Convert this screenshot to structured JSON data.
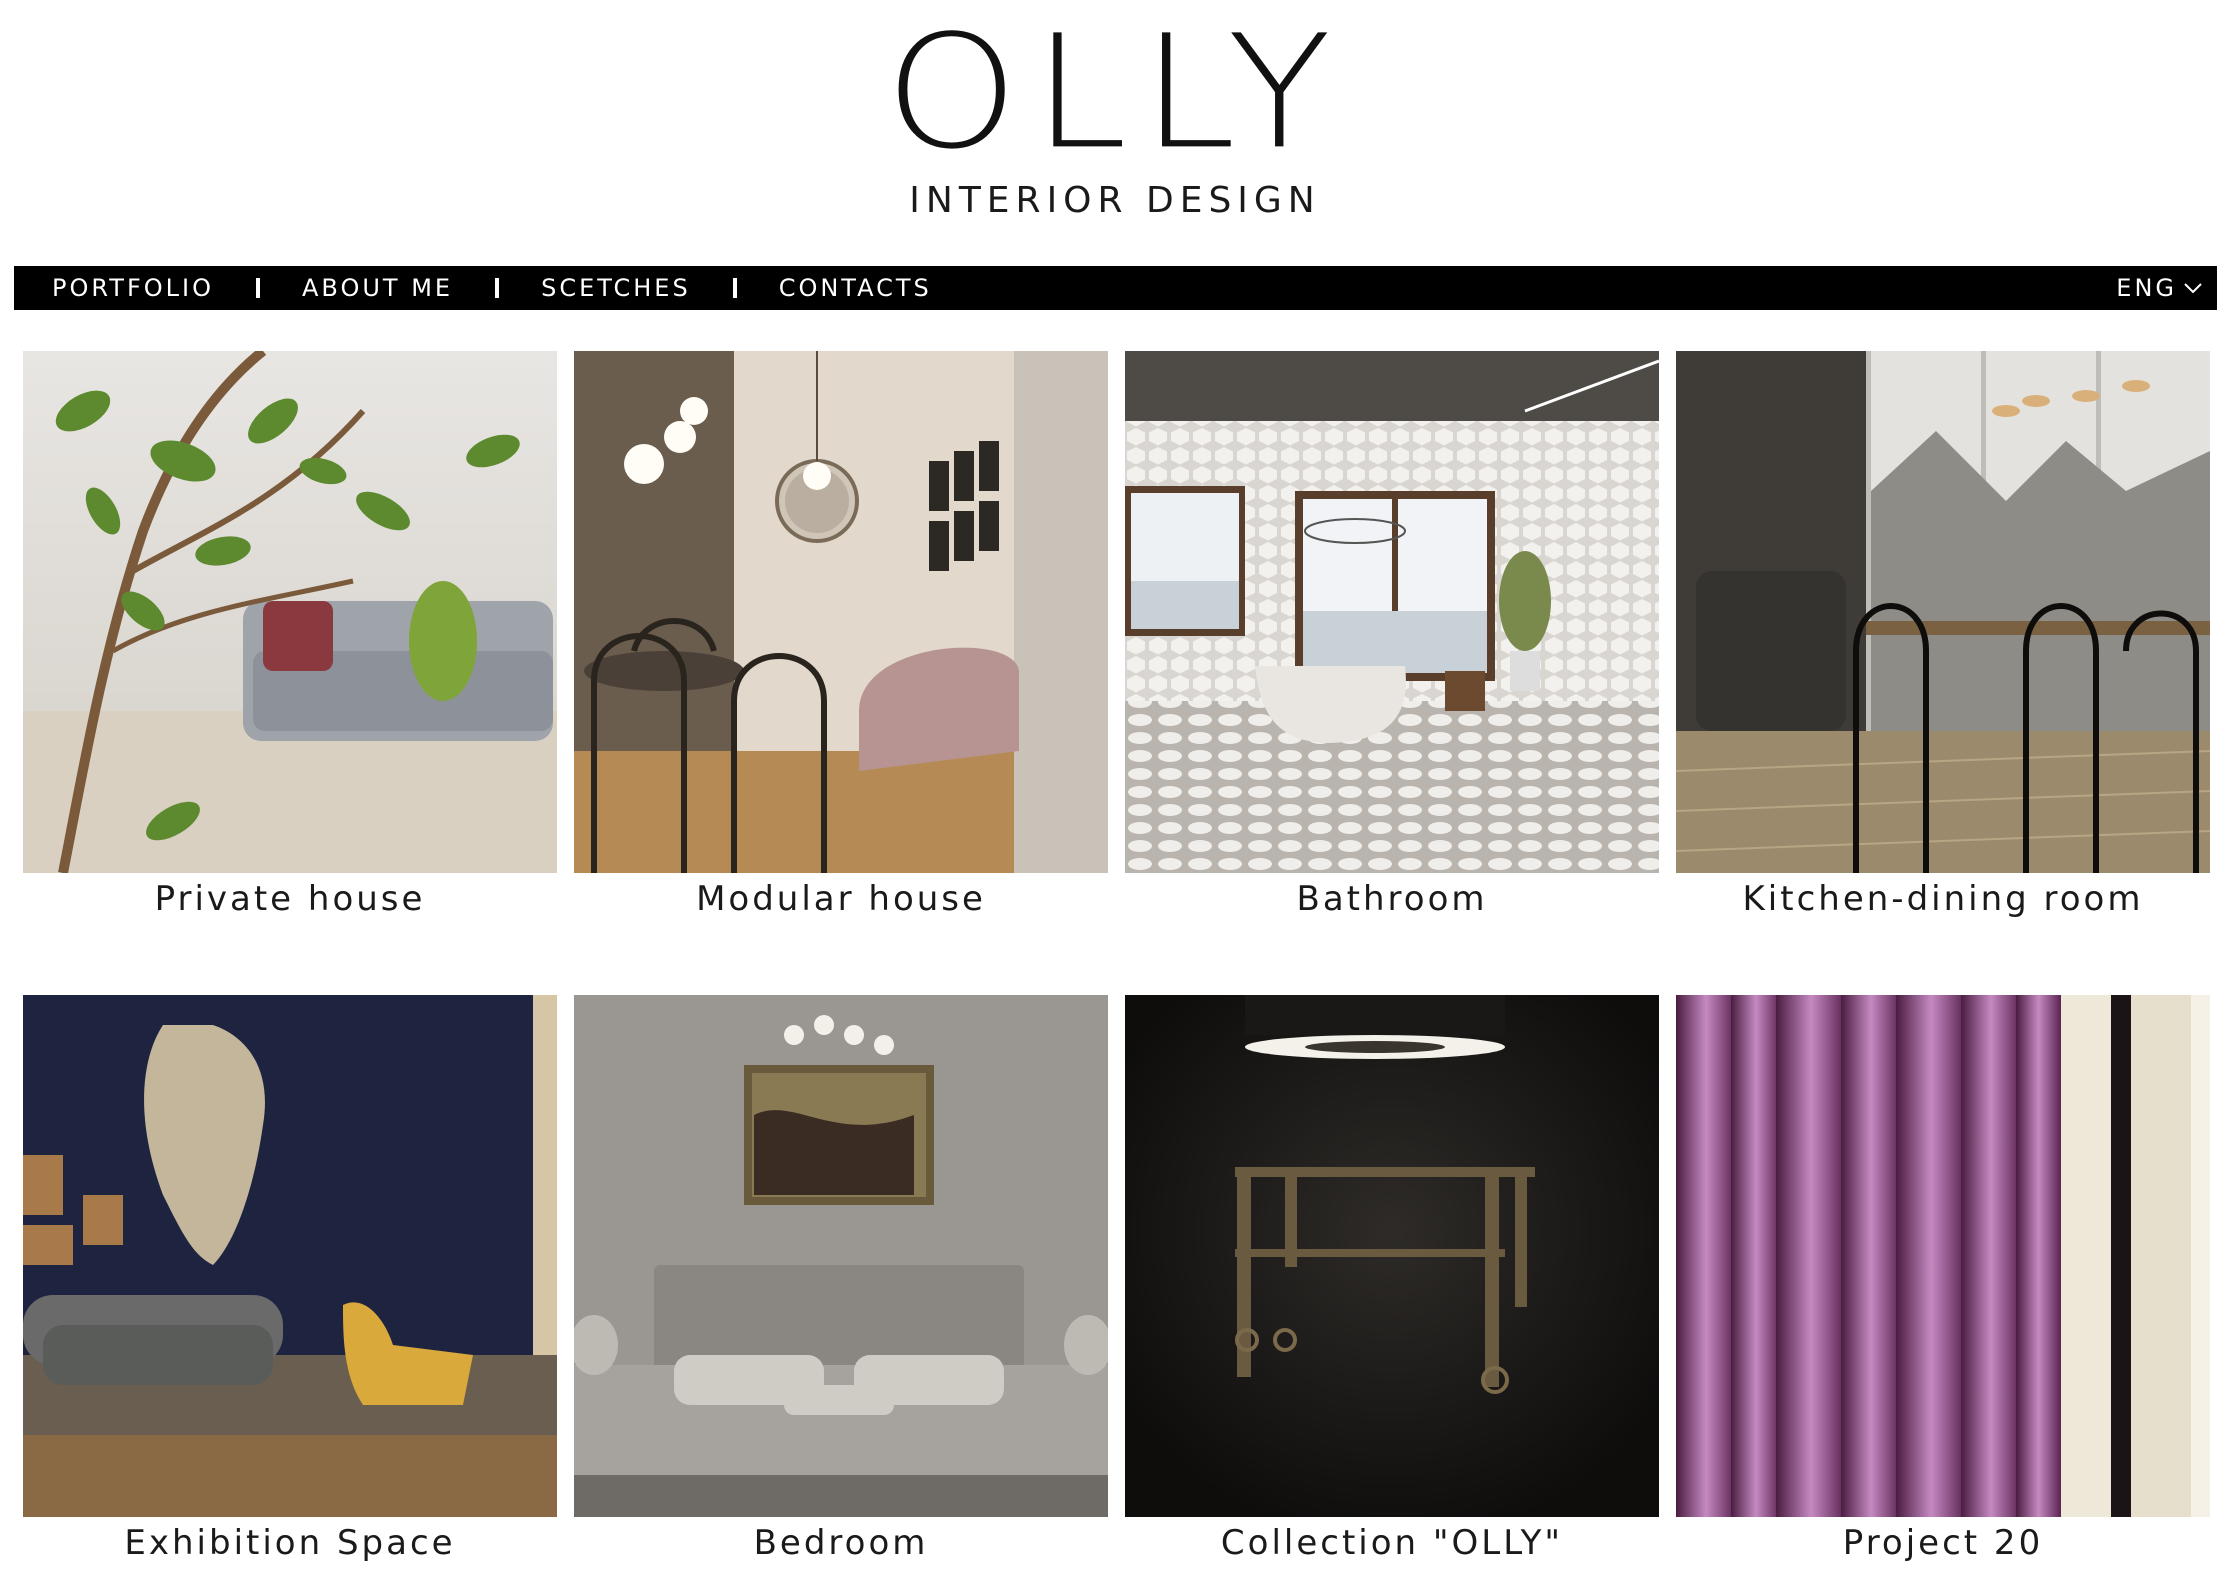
{
  "brand": {
    "logo_text": "OLLY",
    "tagline": "INTERIOR DESIGN"
  },
  "nav": {
    "items": [
      {
        "label": "PORTFOLIO"
      },
      {
        "label": "ABOUT ME"
      },
      {
        "label": "SCETCHES"
      },
      {
        "label": "CONTACTS"
      }
    ],
    "language": "ENG"
  },
  "projects": [
    {
      "title": "Private house"
    },
    {
      "title": "Modular house"
    },
    {
      "title": "Bathroom"
    },
    {
      "title": "Kitchen-dining room"
    },
    {
      "title": "Exhibition Space"
    },
    {
      "title": "Bedroom"
    },
    {
      "title": "Collection \"OLLY\""
    },
    {
      "title": "Project 20"
    }
  ],
  "colors": {
    "nav_background": "#000000",
    "nav_text": "#ffffff",
    "page_background": "#ffffff"
  }
}
